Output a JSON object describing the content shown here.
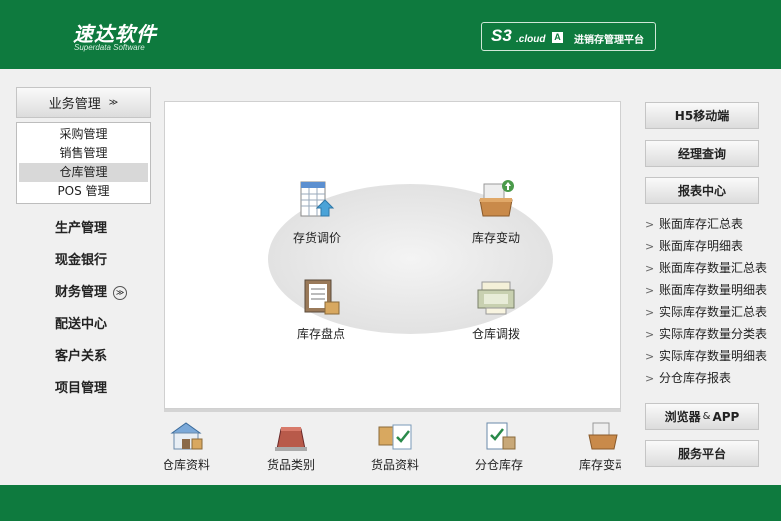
{
  "header": {
    "logo_text": "速达软件",
    "logo_subtext": "Superdata Software",
    "platform": {
      "s3": "S3",
      "cloud": ".cloud",
      "cloud_badge": "A",
      "name": "进销存管理平台"
    }
  },
  "sidebar": {
    "active_module": {
      "label": "业务管理",
      "chevron": "≫"
    },
    "submenu": [
      {
        "label": "采购管理",
        "active": false
      },
      {
        "label": "销售管理",
        "active": false
      },
      {
        "label": "仓库管理",
        "active": true
      },
      {
        "label": "POS 管理",
        "active": false
      }
    ],
    "modules": [
      {
        "label": "生产管理"
      },
      {
        "label": "现金银行"
      },
      {
        "label": "财务管理",
        "chevron": "≫"
      },
      {
        "label": "配送中心"
      },
      {
        "label": "客户关系"
      },
      {
        "label": "项目管理"
      }
    ]
  },
  "flow": {
    "nodes": [
      {
        "label": "存货调价",
        "icon": "price-adjust-icon"
      },
      {
        "label": "库存变动",
        "icon": "inventory-change-icon"
      },
      {
        "label": "库存盘点",
        "icon": "stocktake-icon"
      },
      {
        "label": "仓库调拨",
        "icon": "warehouse-transfer-icon"
      }
    ]
  },
  "bottom_strip": {
    "items": [
      {
        "label": "仓库资料",
        "icon": "warehouse-info-icon"
      },
      {
        "label": "货品类别",
        "icon": "goods-category-icon"
      },
      {
        "label": "货品资料",
        "icon": "goods-info-icon"
      },
      {
        "label": "分仓库存",
        "icon": "branch-stock-icon"
      },
      {
        "label": "库存变动",
        "icon": "inventory-change-icon"
      }
    ]
  },
  "right_panel": {
    "h5_button": "H5移动端",
    "manager_button": "经理查询",
    "report_center_button": "报表中心",
    "reports": [
      "账面库存汇总表",
      "账面库存明细表",
      "账面库存数量汇总表",
      "账面库存数量明细表",
      "实际库存数量汇总表",
      "实际库存数量分类表",
      "实际库存数量明细表",
      "分仓库存报表"
    ],
    "browser_app_button": {
      "left": "浏览器",
      "amp": "&",
      "right": "APP"
    },
    "service_button": "服务平台",
    "arrow_glyph": ">"
  },
  "colors": {
    "brand_green": "#0e7a3e",
    "active_row": "#d8d8d8"
  }
}
